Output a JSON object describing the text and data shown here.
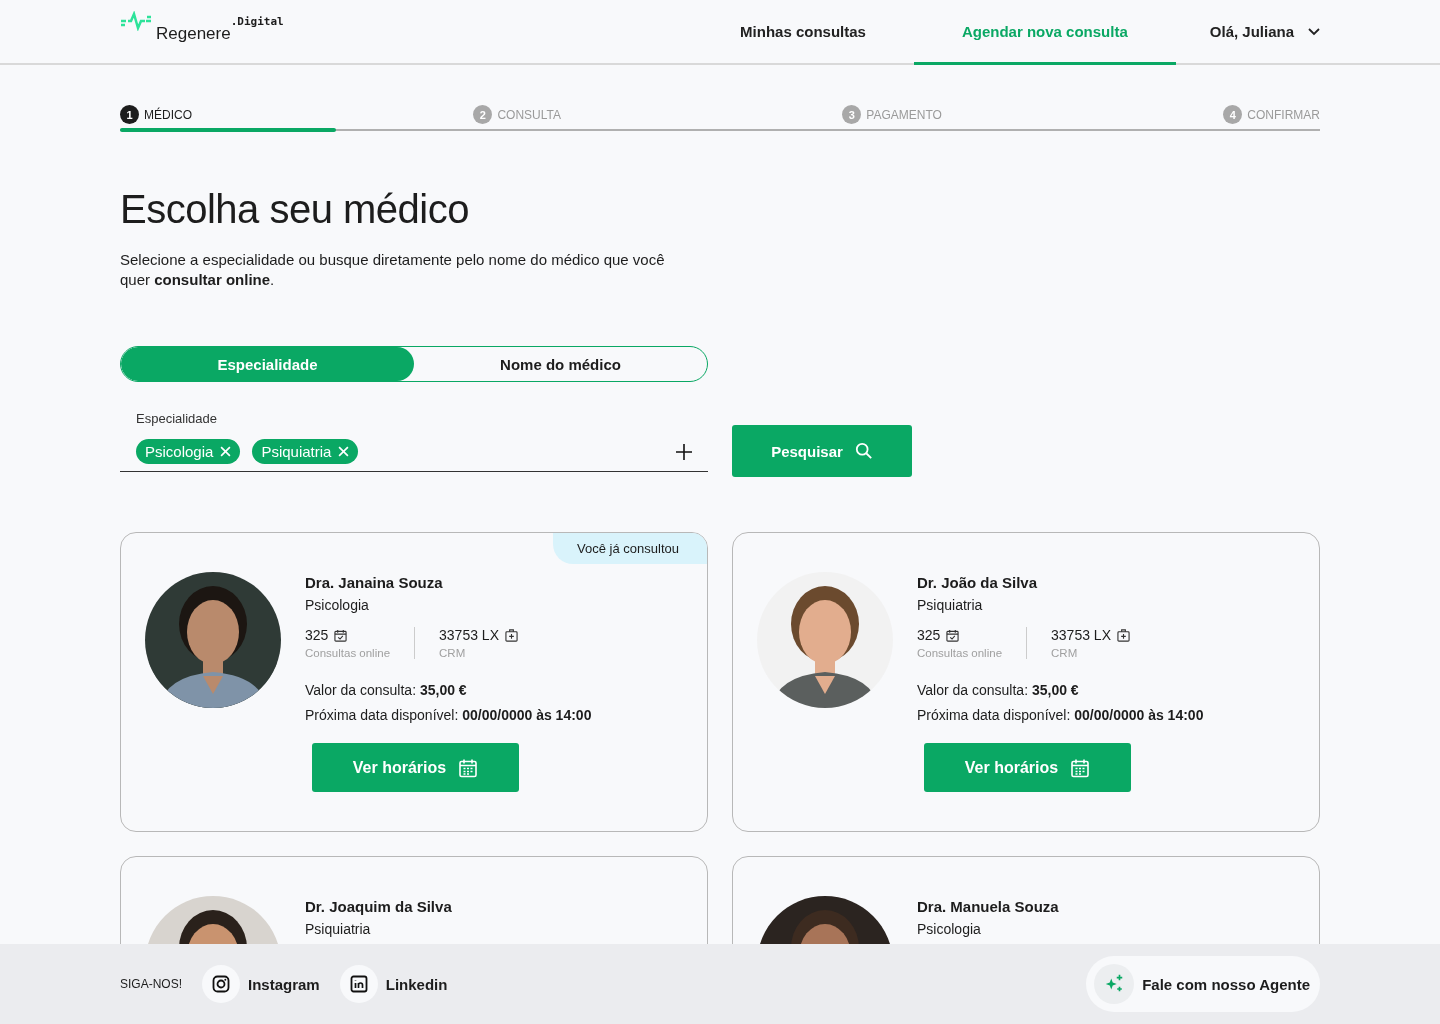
{
  "header": {
    "logo": {
      "name": "Regenere",
      "suffix": ".Digital"
    },
    "nav": [
      {
        "label": "Minhas consultas",
        "selected": false
      },
      {
        "label": "Agendar nova consulta",
        "selected": true
      }
    ],
    "user": {
      "greeting": "Olá, Juliana"
    }
  },
  "stepper": {
    "level": 0.18,
    "steps": [
      {
        "number": "1",
        "label": "MÉDICO",
        "selected": true
      },
      {
        "number": "2",
        "label": "CONSULTA",
        "selected": false
      },
      {
        "number": "3",
        "label": "PAGAMENTO",
        "selected": false
      },
      {
        "number": "4",
        "label": "CONFIRMAR",
        "selected": false
      }
    ]
  },
  "title": "Escolha seu médico",
  "intro": "Selecione a especialidade ou busque diretamente pelo nome do médico que você quer **consultar online**.",
  "search_mode": [
    {
      "label": "Especialidade",
      "selected": true
    },
    {
      "label": "Nome do médico",
      "selected": false
    }
  ],
  "filter": {
    "label": "Especialidade",
    "tags": [
      "Psicologia",
      "Psiquiatria"
    ],
    "button": "Pesquisar"
  },
  "doctors": [
    {
      "name": "Dra. Janaina Souza",
      "specialty": "Psicologia",
      "badge": "Você já consultou",
      "consultations": "325",
      "consultations_label": "Consultas online",
      "crm": "33753 LX",
      "crm_label": "CRM",
      "price": "Valor da consulta: **35,00 €**",
      "next_date": "Próxima data disponível: **00/00/0000 às 14:00**",
      "button": "Ver horários"
    },
    {
      "name": "Dr. João da Silva",
      "specialty": "Psiquiatria",
      "consultations": "325",
      "consultations_label": "Consultas online",
      "crm": "33753 LX",
      "crm_label": "CRM",
      "price": "Valor da consulta: **35,00 €**",
      "next_date": "Próxima data disponível: **00/00/0000 às 14:00**",
      "button": "Ver horários"
    },
    {
      "name": "Dr. Joaquim da Silva",
      "specialty": "Psiquiatria"
    },
    {
      "name": "Dra. Manuela Souza",
      "specialty": "Psicologia"
    }
  ],
  "footer": {
    "follow_label": "SIGA-NOS!",
    "links": [
      {
        "label": "Instagram",
        "kind": "instagram"
      },
      {
        "label": "Linkedin",
        "kind": "linkedin"
      }
    ],
    "agent_button": "Fale com nosso Agente"
  }
}
